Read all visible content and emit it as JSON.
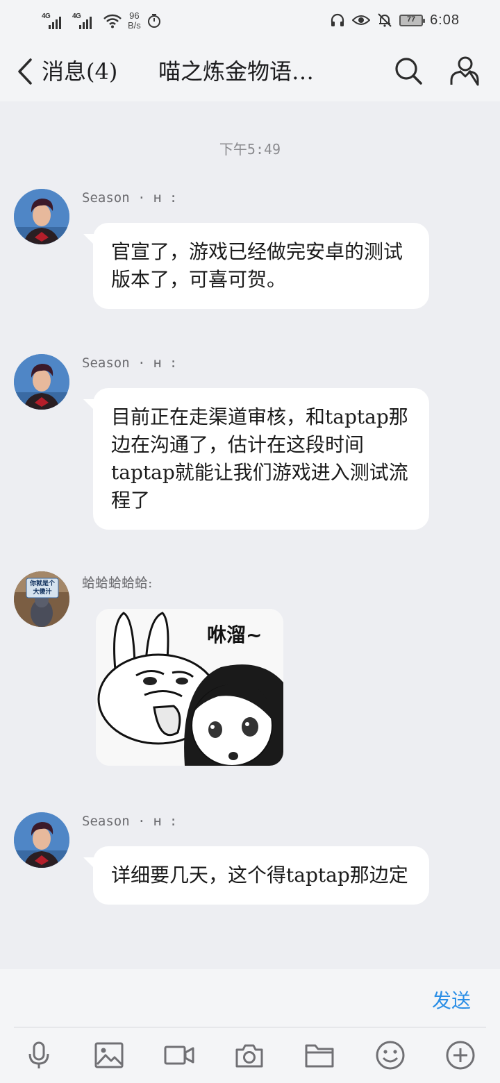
{
  "status_bar": {
    "signal1": "4G",
    "signal2": "4G",
    "speed_value": "96",
    "speed_unit": "B/s",
    "battery": "77",
    "time": "6:08"
  },
  "header": {
    "back_label": "消息(4)",
    "title": "喵之炼金物语…"
  },
  "chat": {
    "timestamp": "下午5:49",
    "messages": [
      {
        "sender": "Season · ʜ :",
        "text": "官宣了，游戏已经做完安卓的测试版本了，可喜可贺。"
      },
      {
        "sender": "Season · ʜ :",
        "text": "目前正在走渠道审核，和taptap那边在沟通了，估计在这段时间taptap就能让我们游戏进入测试流程了"
      },
      {
        "sender": "蛤蛤蛤蛤蛤:",
        "sticker_caption": "咻溜~",
        "avatar_sign": "你就是个大傻汁"
      },
      {
        "sender": "Season · ʜ :",
        "text": "详细要几天，这个得taptap那边定"
      }
    ]
  },
  "input": {
    "send_label": "发送"
  },
  "icons": {
    "toolbar": [
      "microphone-icon",
      "image-icon",
      "video-icon",
      "camera-icon",
      "folder-icon",
      "emoji-icon",
      "plus-icon"
    ]
  },
  "colors": {
    "background": "#edeef2",
    "bubble": "#ffffff",
    "send_accent": "#2a8ee6"
  }
}
